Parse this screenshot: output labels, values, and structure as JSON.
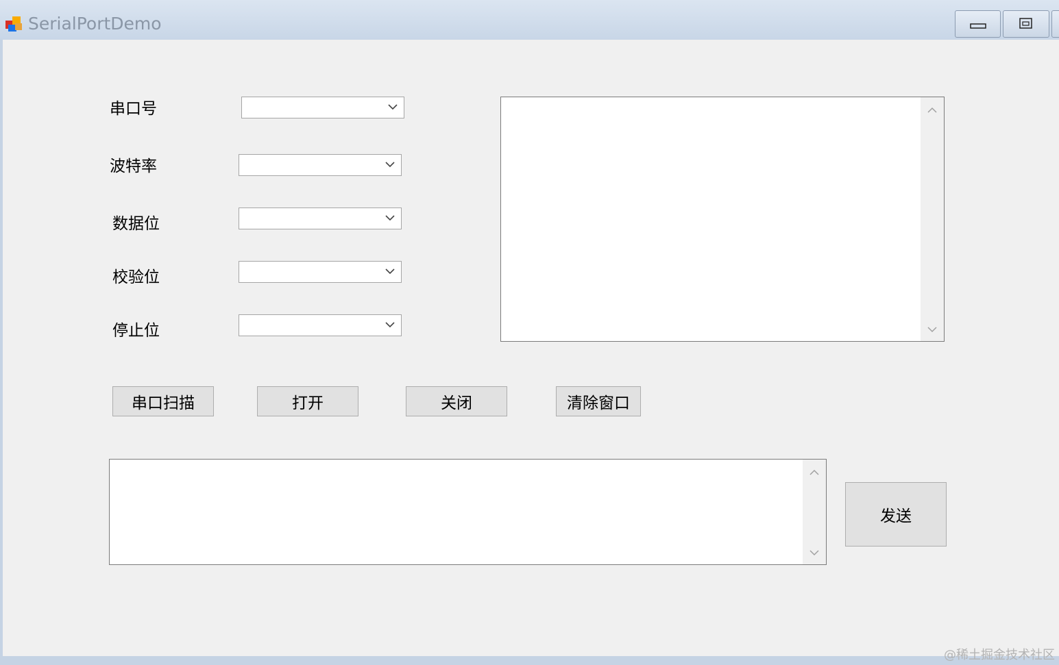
{
  "window": {
    "title": "SerialPortDemo",
    "icon": "windows-forms-app-icon"
  },
  "titlebar_buttons": {
    "minimize_icon": "minimize-icon",
    "maximize_icon": "maximize-icon"
  },
  "form": {
    "fields": [
      {
        "label": "串口号",
        "value": ""
      },
      {
        "label": "波特率",
        "value": ""
      },
      {
        "label": "数据位",
        "value": ""
      },
      {
        "label": "校验位",
        "value": ""
      },
      {
        "label": "停止位",
        "value": ""
      }
    ],
    "buttons": {
      "scan": "串口扫描",
      "open": "打开",
      "close": "关闭",
      "clear": "清除窗口",
      "send": "发送"
    },
    "receive_text": "",
    "send_text": ""
  },
  "watermark": "@稀土掘金技术社区",
  "colors": {
    "titlebar": "#c8d6e7",
    "client_bg": "#f0f0f0",
    "button_bg": "#e1e1e1",
    "title_text": "#8a96a6"
  }
}
